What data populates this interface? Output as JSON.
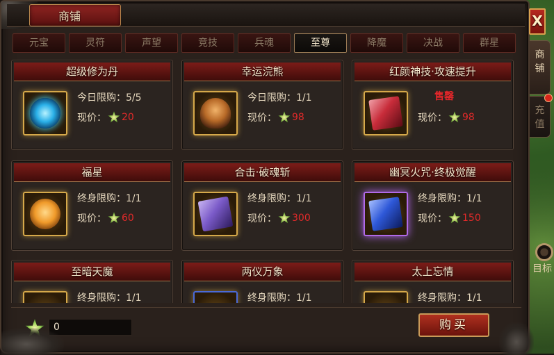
{
  "window": {
    "title": "商铺",
    "close_label": "X"
  },
  "side_tabs": [
    {
      "label": "商铺"
    },
    {
      "label": "充值"
    }
  ],
  "target_label": "目标",
  "tabs": [
    "元宝",
    "灵符",
    "声望",
    "竞技",
    "兵魂",
    "至尊",
    "降魔",
    "决战",
    "群星"
  ],
  "active_tab": "至尊",
  "items": [
    {
      "name": "超级修为丹",
      "limit": "今日限购：5/5",
      "price_label": "现价：",
      "price": "20",
      "icon": "blue-orb-icon",
      "color": "#2ad1ff"
    },
    {
      "name": "幸运浣熊",
      "limit": "今日限购：1/1",
      "price_label": "现价：",
      "price": "98",
      "icon": "raccoon-pet-icon",
      "color": "#d98b3a"
    },
    {
      "name": "红颜神技·攻速提升",
      "soldout": "售罄",
      "price_label": "现价：",
      "price": "98",
      "icon": "red-book-icon",
      "color": "#d84a4a"
    },
    {
      "name": "福星",
      "limit": "终身限购：1/1",
      "price_label": "现价：",
      "price": "60",
      "icon": "fox-pet-icon",
      "color": "#f0a838"
    },
    {
      "name": "合击·破魂斩",
      "limit": "终身限购：1/1",
      "price_label": "现价：",
      "price": "300",
      "icon": "purple-book-icon",
      "color": "#8a6ad0"
    },
    {
      "name": "幽冥火咒·终极觉醒",
      "limit": "终身限购：1/1",
      "price_label": "现价：",
      "price": "150",
      "icon": "blue-book-icon",
      "color": "#3a5ed8"
    },
    {
      "name": "至暗天魔",
      "limit": "终身限购：1/1",
      "icon": "item-icon",
      "color": "#c89a3a"
    },
    {
      "name": "两仪万象",
      "limit": "终身限购：1/1",
      "icon": "item-icon",
      "color": "#4a6ad8"
    },
    {
      "name": "太上忘情",
      "limit": "终身限购：1/1",
      "icon": "item-icon",
      "color": "#c89a3a"
    }
  ],
  "footer": {
    "balance": "0",
    "buy_label": "购买"
  }
}
